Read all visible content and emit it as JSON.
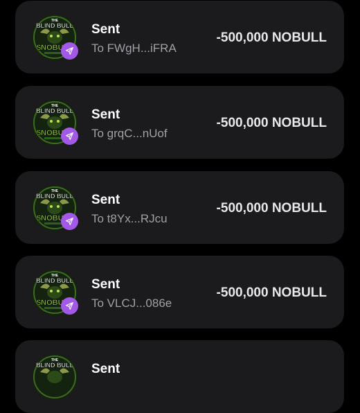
{
  "transactions": [
    {
      "title": "Sent",
      "recipient": "To FWgH...iFRA",
      "amount": "-500,000 NOBULL"
    },
    {
      "title": "Sent",
      "recipient": "To grqC...nUof",
      "amount": "-500,000 NOBULL"
    },
    {
      "title": "Sent",
      "recipient": "To t8Yx...RJcu",
      "amount": "-500,000 NOBULL"
    },
    {
      "title": "Sent",
      "recipient": "To VLCJ...086e",
      "amount": "-500,000 NOBULL"
    },
    {
      "title": "Sent",
      "recipient": "",
      "amount": ""
    }
  ],
  "token_logo": {
    "line1": "THE",
    "line2": "BLIND BULL",
    "ticker": "$NOBULL"
  },
  "icons": {
    "avatar": "token-logo-icon",
    "badge": "send-arrow-icon"
  },
  "colors": {
    "background": "#000000",
    "card": "#1b1b1d",
    "badge": "#a259e8",
    "title": "#ffffff",
    "subtitle": "#a0a0a6",
    "amount": "#e8e8ea"
  }
}
